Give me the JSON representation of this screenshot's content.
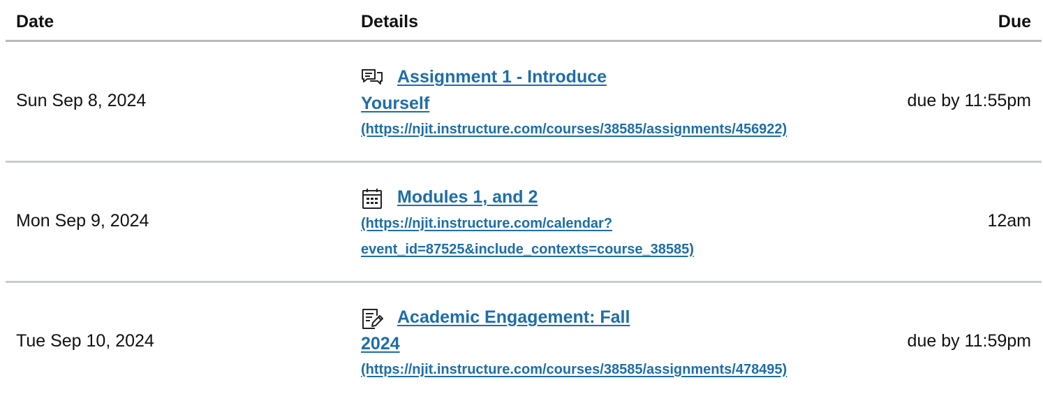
{
  "header": {
    "date": "Date",
    "details": "Details",
    "due": "Due"
  },
  "rows": [
    {
      "date": "Sun Sep 8, 2024",
      "icon": "discussion-icon",
      "title_line1": "Assignment 1 - Introduce",
      "title_line2": "Yourself",
      "url_line1": "(https://njit.instructure.com/courses/38585/assignments/456922)",
      "due": "due by 11:55pm"
    },
    {
      "date": "Mon Sep 9, 2024",
      "icon": "calendar-icon",
      "title_line1": "Modules 1, and 2",
      "url_line1": "(https://njit.instructure.com/calendar?",
      "url_line2": "event_id=87525&include_contexts=course_38585)",
      "due": "12am"
    },
    {
      "date": "Tue Sep 10, 2024",
      "icon": "quiz-icon",
      "title_line1": "Academic Engagement: Fall",
      "title_line2": "2024",
      "url_line1": "(https://njit.instructure.com/courses/38585/assignments/478495)",
      "due": "due by 11:59pm"
    }
  ],
  "colors": {
    "link": "#1d6ea8",
    "text": "#111111",
    "divider": "#c9ccce"
  }
}
